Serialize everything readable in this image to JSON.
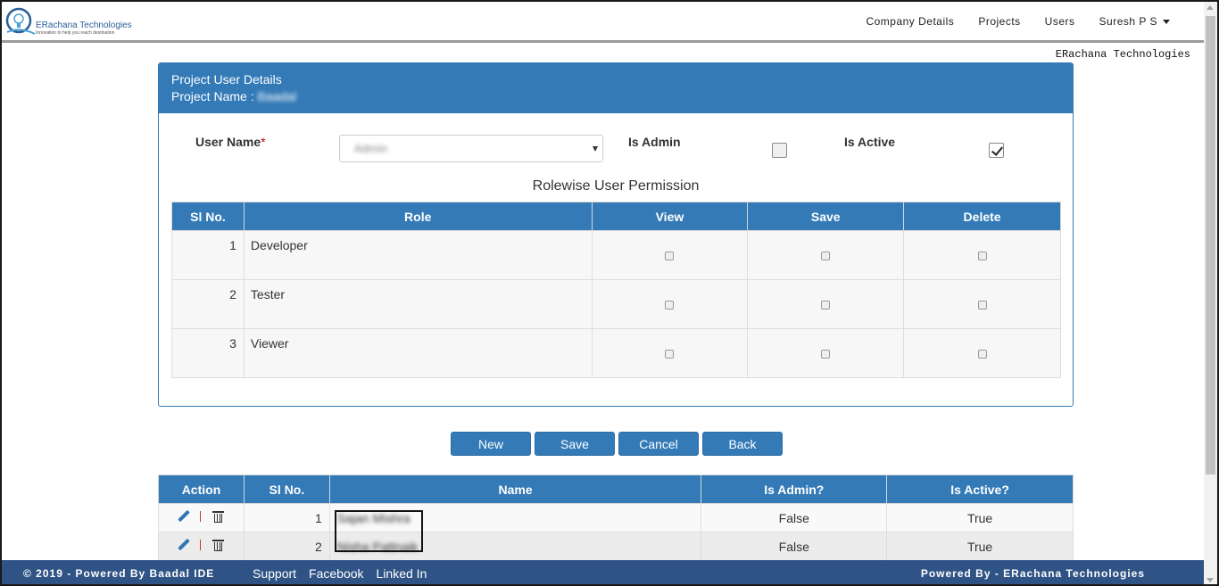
{
  "brand": {
    "logo_text": "ERachana Technologies",
    "tagline": "Innovation to help you reach destination"
  },
  "nav": {
    "items": [
      "Company Details",
      "Projects",
      "Users"
    ],
    "user": "Suresh P S"
  },
  "company_line": "ERachana Technologies",
  "panel": {
    "title": "Project User Details",
    "project_label": "Project Name :",
    "project_value": "Baadal"
  },
  "form": {
    "user_name_label": "User Name",
    "required_mark": "*",
    "user_name_value": "Admin",
    "is_admin_label": "Is Admin",
    "is_admin_checked": false,
    "is_active_label": "Is Active",
    "is_active_checked": true
  },
  "permissions": {
    "title": "Rolewise User Permission",
    "headers": [
      "Sl No.",
      "Role",
      "View",
      "Save",
      "Delete"
    ],
    "rows": [
      {
        "no": "1",
        "role": "Developer"
      },
      {
        "no": "2",
        "role": "Tester"
      },
      {
        "no": "3",
        "role": "Viewer"
      }
    ]
  },
  "buttons": {
    "new": "New",
    "save": "Save",
    "cancel": "Cancel",
    "back": "Back"
  },
  "users_table": {
    "headers": [
      "Action",
      "Sl No.",
      "Name",
      "Is Admin?",
      "Is Active?"
    ],
    "rows": [
      {
        "no": "1",
        "name": "Sajan Mishra",
        "is_admin": "False",
        "is_active": "True"
      },
      {
        "no": "2",
        "name": "Nisha Pattnaik",
        "is_admin": "False",
        "is_active": "True"
      }
    ]
  },
  "footer": {
    "left": "© 2019 - Powered By Baadal IDE",
    "links": [
      "Support",
      "Facebook",
      "Linked In"
    ],
    "right": "Powered By - ERachana Technologies"
  },
  "colors": {
    "primary": "#337ab7",
    "footer": "#2f5385"
  }
}
